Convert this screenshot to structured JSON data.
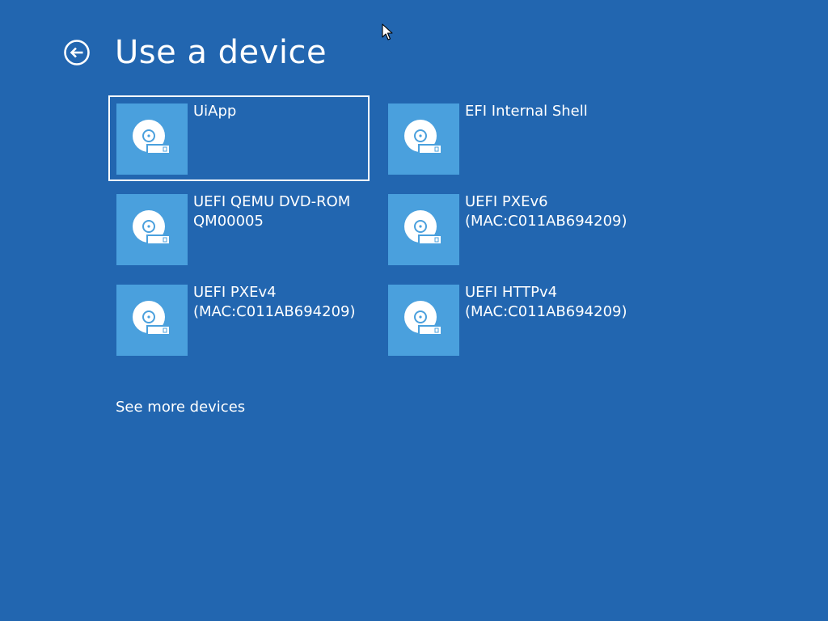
{
  "header": {
    "title": "Use a device",
    "back_icon": "back-arrow-circle-icon"
  },
  "devices": [
    {
      "label": "UiApp",
      "icon": "disk-drive-icon",
      "selected": true
    },
    {
      "label": "EFI Internal Shell",
      "icon": "disk-drive-icon",
      "selected": false
    },
    {
      "label": "UEFI QEMU DVD-ROM QM00005",
      "icon": "disk-drive-icon",
      "selected": false
    },
    {
      "label": "UEFI PXEv6 (MAC:C011AB694209)",
      "icon": "disk-drive-icon",
      "selected": false
    },
    {
      "label": "UEFI PXEv4 (MAC:C011AB694209)",
      "icon": "disk-drive-icon",
      "selected": false
    },
    {
      "label": "UEFI HTTPv4 (MAC:C011AB694209)",
      "icon": "disk-drive-icon",
      "selected": false
    }
  ],
  "footer": {
    "see_more": "See more devices"
  },
  "colors": {
    "background": "#2266b0",
    "tile_icon_bg": "#4aa0dd",
    "text": "#ffffff"
  }
}
